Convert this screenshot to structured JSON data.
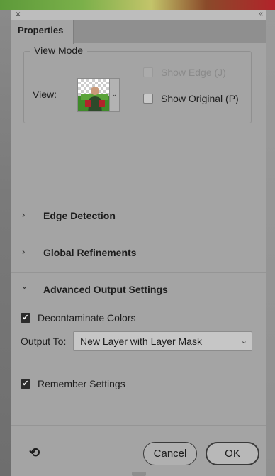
{
  "panel": {
    "close_glyph": "×",
    "collapse_glyph": "‹‹",
    "tab": "Properties"
  },
  "view_mode": {
    "legend": "View Mode",
    "view_label": "View:",
    "show_edge": {
      "label": "Show Edge (J)",
      "checked": false,
      "disabled": true
    },
    "show_original": {
      "label": "Show Original (P)",
      "checked": false,
      "disabled": false
    }
  },
  "sections": {
    "edge_detection": {
      "label": "Edge Detection",
      "expanded": false
    },
    "global_refinements": {
      "label": "Global Refinements",
      "expanded": false
    },
    "advanced_output": {
      "label": "Advanced Output Settings",
      "expanded": true
    }
  },
  "output": {
    "decontaminate": {
      "label": "Decontaminate Colors",
      "checked": true
    },
    "output_to_label": "Output To:",
    "output_to_value": "New Layer with Layer Mask"
  },
  "remember": {
    "label": "Remember Settings",
    "checked": true
  },
  "footer": {
    "cancel_label": "Cancel",
    "ok_label": "OK"
  },
  "icons": {
    "chevron_right": "›",
    "chevron_down": "⌄",
    "reset": "⟲",
    "checkmark": "✓"
  }
}
